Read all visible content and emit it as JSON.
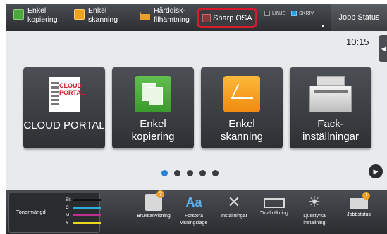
{
  "topbar": {
    "shortcuts": [
      {
        "label": "Enkel\nkopiering",
        "icon": "copy-icon"
      },
      {
        "label": "Enkel\nskanning",
        "icon": "scan-icon"
      },
      {
        "label": "Hårddisk-\nfilhämtning",
        "icon": "folder-icon"
      }
    ],
    "sharp_osa_label": "Sharp OSA",
    "status_line": "LINJE",
    "status_write": "SKRIV.",
    "job_status_label": "Jobb Status"
  },
  "time": "10:15",
  "tiles": [
    {
      "label": "CLOUD PORTAL",
      "logo_text": "CLOUD\nPORTAL",
      "icon": "cloud-portal-logo"
    },
    {
      "label": "Enkel\nkopiering",
      "icon": "copy-icon"
    },
    {
      "label": "Enkel\nskanning",
      "icon": "scan-icon"
    },
    {
      "label": "Fack-\ninställningar",
      "icon": "printer-icon"
    }
  ],
  "pager": {
    "count": 5,
    "active": 1
  },
  "bottombar": {
    "toner": {
      "title": "Tonermängd",
      "colors": [
        {
          "code": "Bk",
          "color": "#111111"
        },
        {
          "code": "C",
          "color": "#2ab0d8"
        },
        {
          "code": "M",
          "color": "#c03090"
        },
        {
          "code": "Y",
          "color": "#e8d820"
        }
      ]
    },
    "items": [
      {
        "label": "Bruksanvisning",
        "icon": "manual-icon"
      },
      {
        "label": "Förstora\nvisningsläge",
        "icon": "zoom-text-icon"
      },
      {
        "label": "Inställningar",
        "icon": "tools-icon"
      },
      {
        "label": "Total räkning",
        "icon": "counter-icon"
      },
      {
        "label": "Ljusstyrka\ninställning",
        "icon": "brightness-icon"
      },
      {
        "label": "Jobbstatus",
        "icon": "job-status-icon"
      }
    ]
  }
}
